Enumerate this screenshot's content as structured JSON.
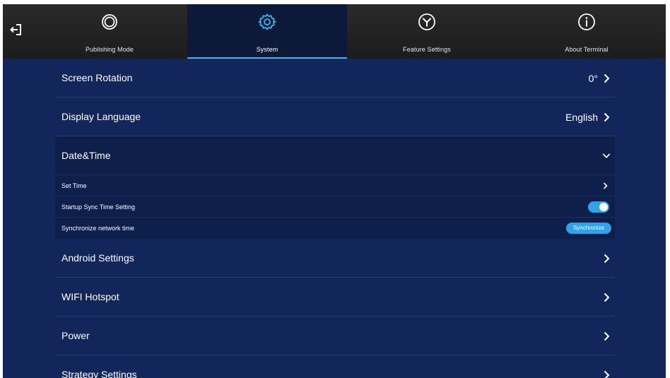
{
  "nav": {
    "tabs": [
      {
        "label": "Publishing Mode",
        "icon": "publishing-mode-icon",
        "active": false
      },
      {
        "label": "System",
        "icon": "gear-icon",
        "active": true
      },
      {
        "label": "Feature Settings",
        "icon": "feature-settings-icon",
        "active": false
      },
      {
        "label": "About Terminal",
        "icon": "info-icon",
        "active": false
      }
    ],
    "exit_icon": "exit-icon"
  },
  "settings": {
    "screen_rotation": {
      "label": "Screen Rotation",
      "value": "0°"
    },
    "display_language": {
      "label": "Display Language",
      "value": "English"
    },
    "date_time": {
      "label": "Date&Time",
      "expanded": true,
      "set_time": {
        "label": "Set Time"
      },
      "startup_sync": {
        "label": "Startup Sync Time Setting",
        "enabled": true
      },
      "sync_network": {
        "label": "Synchronize network time",
        "button_label": "Synchronize"
      }
    },
    "android_settings": {
      "label": "Android Settings"
    },
    "wifi_hotspot": {
      "label": "WIFI Hotspot"
    },
    "power": {
      "label": "Power"
    },
    "strategy_settings": {
      "label": "Strategy Settings"
    }
  },
  "colors": {
    "background": "#13265b",
    "topbar": "#222222",
    "active_tab": "#0d1938",
    "accent": "#35b8f2",
    "toggle": "#2fa2ee"
  }
}
